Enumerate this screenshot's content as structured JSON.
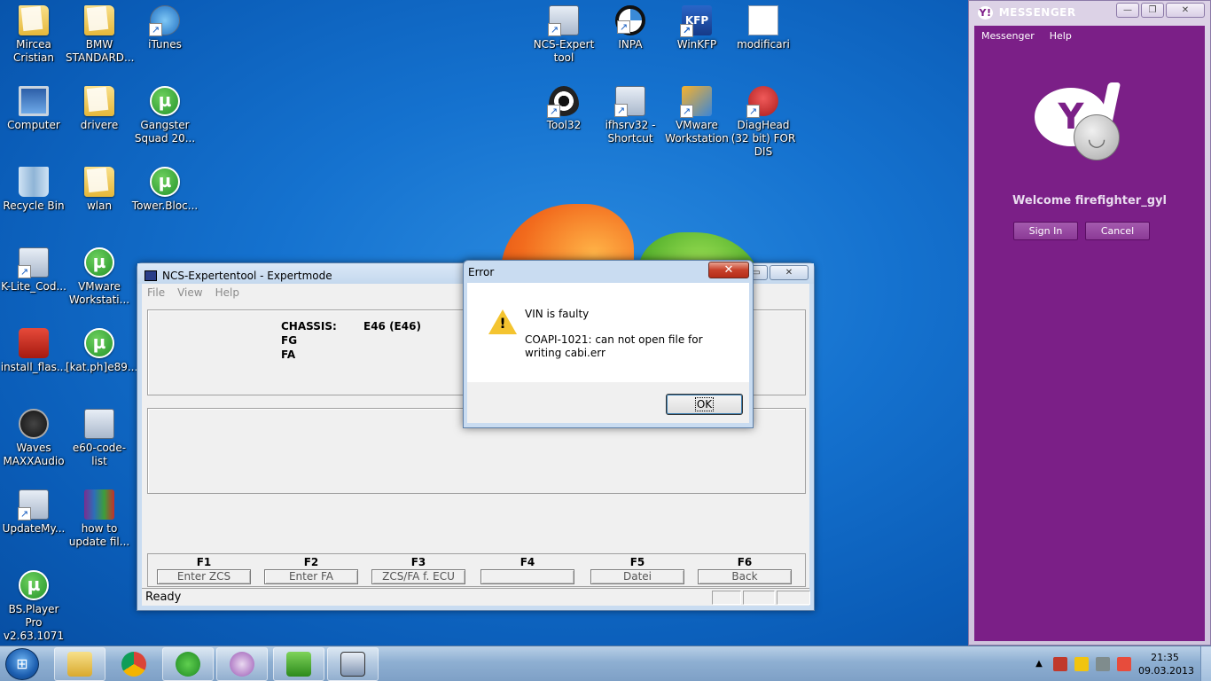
{
  "desktop": {
    "icons_col1": [
      {
        "label": "Mircea Cristian",
        "icon": "user-folder-icon"
      },
      {
        "label": "Computer",
        "icon": "computer-icon"
      },
      {
        "label": "Recycle Bin",
        "icon": "recycle-bin-icon"
      },
      {
        "label": "K-Lite_Cod...",
        "icon": "klite-codec-icon"
      },
      {
        "label": "install_flas...",
        "icon": "flash-installer-icon"
      },
      {
        "label": "Waves MAXXAudio",
        "icon": "waves-audio-icon"
      },
      {
        "label": "UpdateMy...",
        "icon": "update-icon"
      },
      {
        "label": "BS.Player Pro v2.63.1071 ...",
        "icon": "utorrent-icon"
      }
    ],
    "icons_col2": [
      {
        "label": "BMW STANDARD...",
        "icon": "folder-icon"
      },
      {
        "label": "drivere",
        "icon": "folder-icon"
      },
      {
        "label": "wlan",
        "icon": "folder-icon"
      },
      {
        "label": "VMware Workstati...",
        "icon": "utorrent-icon"
      },
      {
        "label": "[kat.ph]e89...",
        "icon": "utorrent-icon"
      },
      {
        "label": "e60-code-list",
        "icon": "document-icon"
      },
      {
        "label": "how to update fil...",
        "icon": "winrar-icon"
      }
    ],
    "icons_col3": [
      {
        "label": "iTunes",
        "icon": "itunes-icon"
      },
      {
        "label": "Gangster Squad 20...",
        "icon": "utorrent-icon"
      },
      {
        "label": "Tower.Bloc...",
        "icon": "utorrent-icon"
      }
    ],
    "icons_top": [
      {
        "label": "NCS-Expert tool",
        "icon": "ncs-expert-icon"
      },
      {
        "label": "INPA",
        "icon": "bmw-inpa-icon"
      },
      {
        "label": "WinKFP",
        "icon": "winkfp-icon"
      },
      {
        "label": "modificari",
        "icon": "text-file-icon"
      }
    ],
    "icons_top2": [
      {
        "label": "Tool32",
        "icon": "tool32-eye-icon"
      },
      {
        "label": "ifhsrv32 - Shortcut",
        "icon": "network-icon"
      },
      {
        "label": "VMware Workstation",
        "icon": "vmware-icon"
      },
      {
        "label": "DiagHead (32 bit) FOR DIS",
        "icon": "diaghead-icon"
      }
    ]
  },
  "ncs_window": {
    "title": "NCS-Expertentool - Expertmode",
    "menu": [
      "File",
      "View",
      "Help"
    ],
    "info": {
      "chassis_label": "CHASSIS:",
      "chassis_value": "E46 (E46)",
      "fg_label": "FG",
      "fa_label": "FA"
    },
    "fkeys": [
      {
        "key": "F1",
        "button": "Enter ZCS"
      },
      {
        "key": "F2",
        "button": "Enter FA"
      },
      {
        "key": "F3",
        "button": "ZCS/FA f. ECU"
      },
      {
        "key": "F4",
        "button": ""
      },
      {
        "key": "F5",
        "button": "Datei"
      },
      {
        "key": "F6",
        "button": "Back"
      }
    ],
    "status": "Ready"
  },
  "error_dialog": {
    "title": "Error",
    "close_glyph": "✕",
    "message1": "VIN is faulty",
    "message2": "COAPI-1021: can not open file for writing cabi.err",
    "ok_label": "OK"
  },
  "messenger": {
    "title": "MESSENGER",
    "menu": [
      "Messenger",
      "Help"
    ],
    "welcome": "Welcome firefighter_gyl",
    "sign_in": "Sign In",
    "cancel": "Cancel"
  },
  "taskbar": {
    "pinned": [
      "explorer-icon",
      "chrome-icon",
      "utorrent-icon",
      "yahoo-messenger-icon",
      "ediabas-icon",
      "ncs-expert-icon"
    ],
    "clock_time": "21:35",
    "clock_date": "09.03.2013"
  }
}
